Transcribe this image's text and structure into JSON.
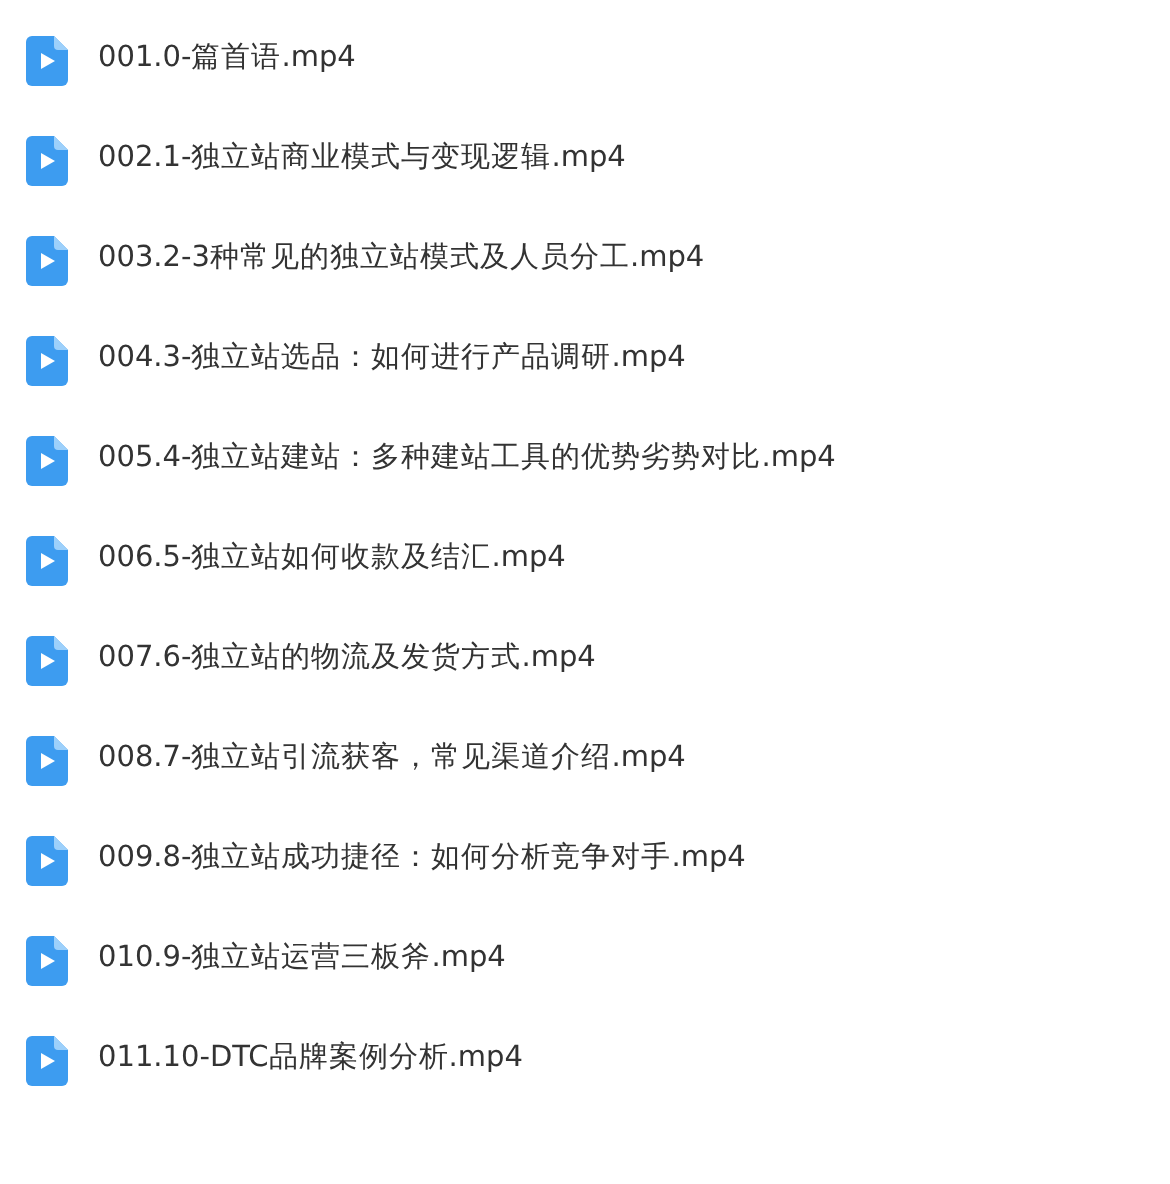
{
  "files": [
    {
      "name": "001.0-篇首语.mp4"
    },
    {
      "name": "002.1-独立站商业模式与变现逻辑.mp4"
    },
    {
      "name": "003.2-3种常见的独立站模式及人员分工.mp4"
    },
    {
      "name": "004.3-独立站选品：如何进行产品调研.mp4"
    },
    {
      "name": "005.4-独立站建站：多种建站工具的优势劣势对比.mp4"
    },
    {
      "name": "006.5-独立站如何收款及结汇.mp4"
    },
    {
      "name": "007.6-独立站的物流及发货方式.mp4"
    },
    {
      "name": "008.7-独立站引流获客，常见渠道介绍.mp4"
    },
    {
      "name": "009.8-独立站成功捷径：如何分析竞争对手.mp4"
    },
    {
      "name": "010.9-独立站运营三板斧.mp4"
    },
    {
      "name": "011.10-DTC品牌案例分析.mp4"
    }
  ]
}
